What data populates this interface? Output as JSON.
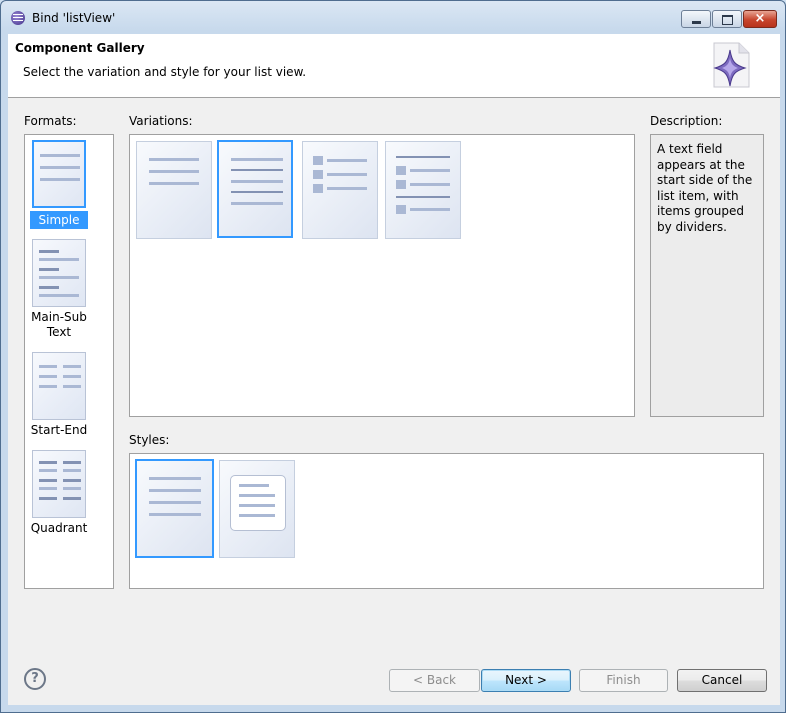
{
  "window": {
    "title": "Bind 'listView'",
    "close_glyph": "×"
  },
  "banner": {
    "title": "Component Gallery",
    "message": "Select the variation and style for your list view."
  },
  "formats": {
    "label": "Formats:",
    "items": [
      {
        "label": "Simple",
        "selected": true
      },
      {
        "label": "Main-Sub Text",
        "selected": false
      },
      {
        "label": "Start-End",
        "selected": false
      },
      {
        "label": "Quadrant",
        "selected": false
      }
    ]
  },
  "variations": {
    "label": "Variations:",
    "count": 4,
    "selected_index": 1
  },
  "description": {
    "label": "Description:",
    "text": "A text field appears at the start side of the list item, with items grouped by dividers."
  },
  "styles": {
    "label": "Styles:",
    "count": 2,
    "selected_index": 0
  },
  "buttons": {
    "help": "?",
    "back": "< Back",
    "next": "Next >",
    "finish": "Finish",
    "cancel": "Cancel"
  },
  "colors": {
    "selection": "#3399ff",
    "dialog_bg": "#f0f0f0",
    "frame": "#c7d9ec"
  }
}
